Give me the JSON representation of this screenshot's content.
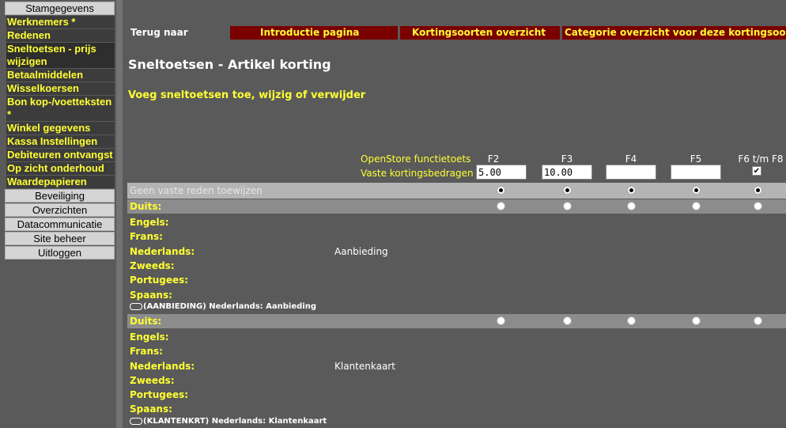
{
  "sidebar": {
    "items": [
      {
        "label": "Stamgegevens",
        "style": "grey"
      },
      {
        "label": "Werknemers *",
        "style": "yellow"
      },
      {
        "label": "Redenen",
        "style": "yellow"
      },
      {
        "label": "Sneltoetsen - prijs wijzigen",
        "style": "yellow-active"
      },
      {
        "label": "Betaalmiddelen",
        "style": "yellow"
      },
      {
        "label": "Wisselkoersen",
        "style": "yellow"
      },
      {
        "label": "Bon kop-/voetteksten *",
        "style": "yellow"
      },
      {
        "label": "Winkel gegevens",
        "style": "yellow"
      },
      {
        "label": "Kassa Instellingen",
        "style": "yellow"
      },
      {
        "label": "Debiteuren ontvangst",
        "style": "yellow"
      },
      {
        "label": "Op zicht onderhoud",
        "style": "yellow"
      },
      {
        "label": "Waardepapieren",
        "style": "yellow"
      },
      {
        "label": "Beveiliging",
        "style": "grey"
      },
      {
        "label": "Overzichten",
        "style": "grey"
      },
      {
        "label": "Datacommunicatie",
        "style": "grey"
      },
      {
        "label": "Site beheer",
        "style": "grey"
      },
      {
        "label": "Uitloggen",
        "style": "grey"
      }
    ]
  },
  "nav": {
    "back_label": "Terug naar",
    "tabs": [
      "Introductie pagina",
      "Kortingsoorten overzicht",
      "Categorie overzicht voor deze kortingsoort"
    ]
  },
  "page": {
    "title": "Sneltoetsen - Artikel korting",
    "subtitle": "Voeg sneltoetsen toe, wijzig of verwijder"
  },
  "keys": {
    "function_label": "OpenStore functietoets",
    "amounts_label": "Vaste kortingsbedragen",
    "headers": [
      "F2",
      "F3",
      "F4",
      "F5",
      "F6 t/m F8"
    ],
    "amounts": [
      "5.00",
      "10.00",
      "",
      ""
    ],
    "f6_checked": true
  },
  "no_reason_label": "Geen vaste reden toewijzen",
  "reasons": [
    {
      "band_label": "Duits:",
      "languages": [
        "Engels:",
        "Frans:",
        "Nederlands:",
        "Zweeds:",
        "Portugees:",
        "Spaans:"
      ],
      "value": "Aanbieding",
      "code": "(AANBIEDING) Nederlands: Aanbieding"
    },
    {
      "band_label": "Duits:",
      "languages": [
        "Engels:",
        "Frans:",
        "Nederlands:",
        "Zweeds:",
        "Portugees:",
        "Spaans:"
      ],
      "value": "Klantenkaart",
      "code": "(KLANTENKRT) Nederlands: Klantenkaart"
    }
  ],
  "colors": {
    "background": "#5a5a5a",
    "accent_yellow": "#ffff33",
    "tab_red": "#7a0000",
    "band_light": "#b4b4b4",
    "band_dark": "#8c8c8c"
  }
}
